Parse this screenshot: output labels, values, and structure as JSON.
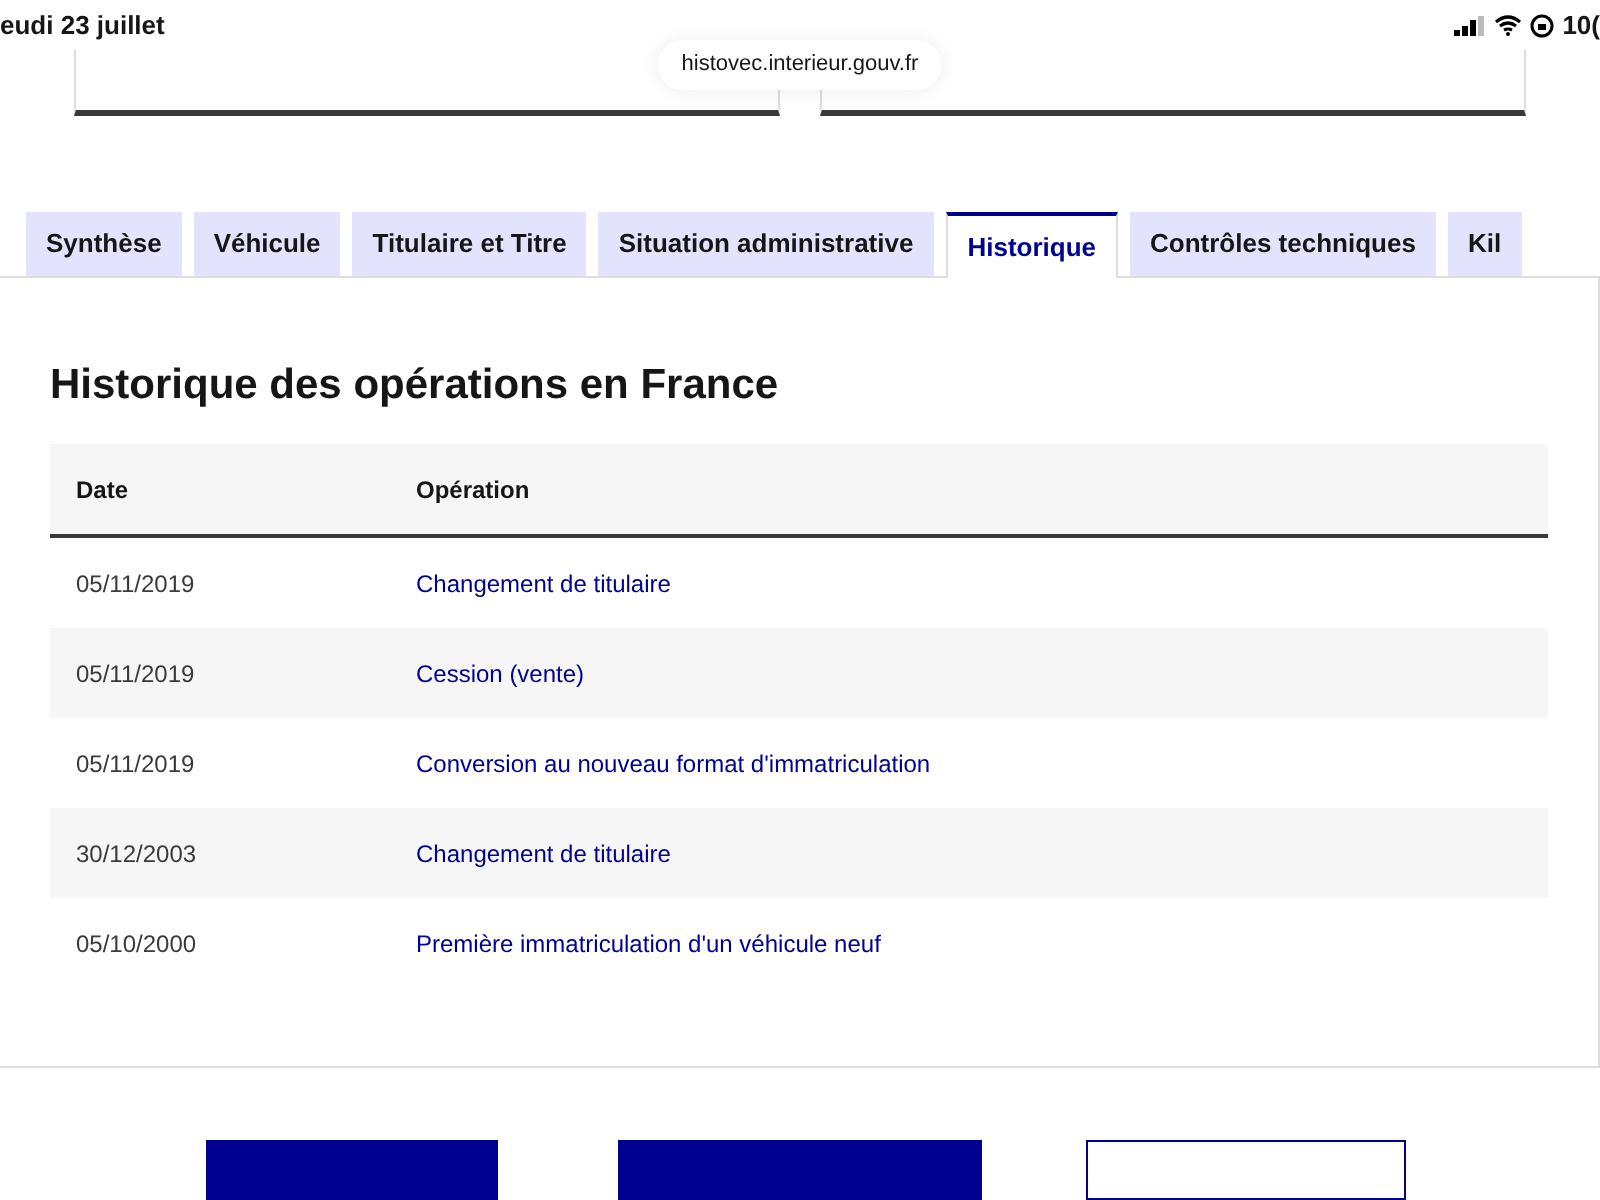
{
  "status_bar": {
    "date": "eudi 23 juillet",
    "battery": "10("
  },
  "url_bar": {
    "url": "histovec.interieur.gouv.fr"
  },
  "tabs": [
    {
      "label": "Synthèse",
      "selected": false
    },
    {
      "label": "Véhicule",
      "selected": false
    },
    {
      "label": "Titulaire et Titre",
      "selected": false
    },
    {
      "label": "Situation administrative",
      "selected": false
    },
    {
      "label": "Historique",
      "selected": true
    },
    {
      "label": "Contrôles techniques",
      "selected": false
    },
    {
      "label": "Kil",
      "selected": false
    }
  ],
  "section": {
    "title": "Historique des opérations en France",
    "table": {
      "columns": [
        "Date",
        "Opération"
      ],
      "rows": [
        {
          "date": "05/11/2019",
          "operation": "Changement de titulaire"
        },
        {
          "date": "05/11/2019",
          "operation": "Cession (vente)"
        },
        {
          "date": "05/11/2019",
          "operation": "Conversion au nouveau format d'immatriculation"
        },
        {
          "date": "30/12/2003",
          "operation": "Changement de titulaire"
        },
        {
          "date": "05/10/2000",
          "operation": "Première immatriculation d'un véhicule neuf"
        }
      ]
    }
  },
  "bottom_buttons": [
    {
      "kind": "filled"
    },
    {
      "kind": "filled"
    },
    {
      "kind": "outline"
    }
  ]
}
